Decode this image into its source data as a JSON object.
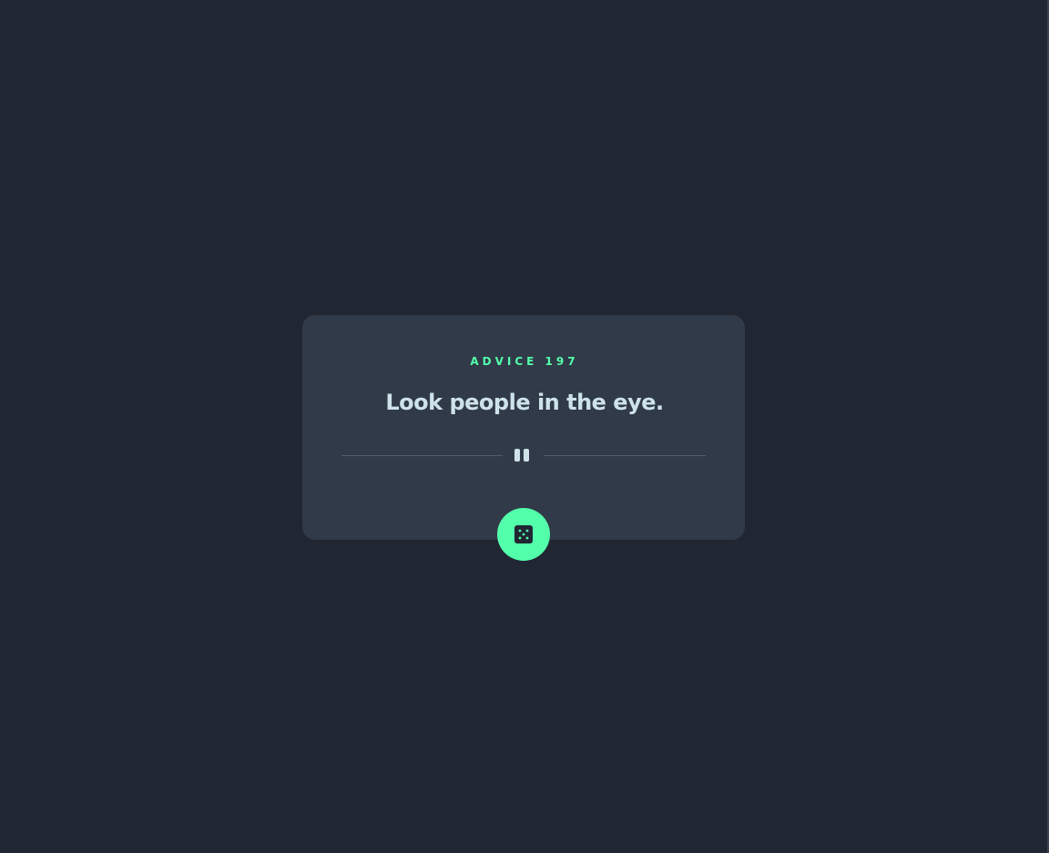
{
  "advice": {
    "label": "ADVICE 197",
    "text": "Look people in the eye."
  },
  "divider": {
    "icon": "pause-icon"
  },
  "button": {
    "icon": "dice-icon"
  },
  "colors": {
    "background": "#202632",
    "card": "#313a48",
    "accent": "#53ffab",
    "text": "#cee3e9",
    "divider": "#4f5d74"
  }
}
